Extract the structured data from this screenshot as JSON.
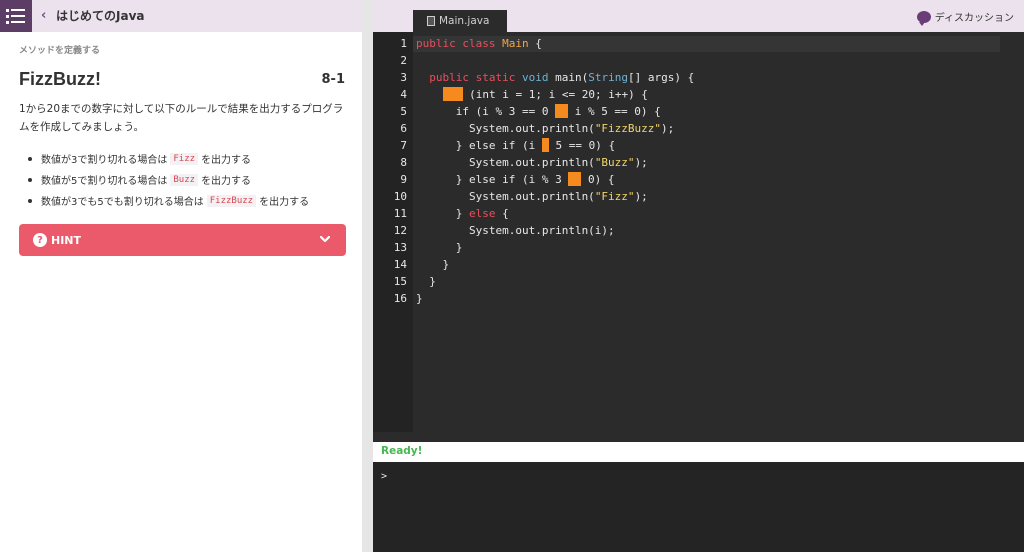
{
  "header": {
    "course_title": "はじめてのJava",
    "discussion_label": "ディスカッション"
  },
  "exercise": {
    "section_label": "メソッドを定義する",
    "title": "FizzBuzz!",
    "number": "8-1",
    "description": "1から20までの数字に対して以下のルールで結果を出力するプログラムを作成してみましょう。",
    "rules": [
      {
        "before": "数値が3で割り切れる場合は",
        "code": "Fizz",
        "after": "を出力する"
      },
      {
        "before": "数値が5で割り切れる場合は",
        "code": "Buzz",
        "after": "を出力する"
      },
      {
        "before": "数値が3でも5でも割り切れる場合は",
        "code": "FizzBuzz",
        "after": "を出力する"
      }
    ],
    "hint_label": "HINT"
  },
  "editor": {
    "file_tab": "Main.java",
    "line_numbers": [
      "1",
      "2",
      "3",
      "4",
      "5",
      "6",
      "7",
      "8",
      "9",
      "10",
      "11",
      "12",
      "13",
      "14",
      "15",
      "16"
    ]
  },
  "console": {
    "status": "Ready!",
    "prompt": ">"
  },
  "colors": {
    "accent_purple": "#5c3d66",
    "hint_red": "#ea5a6b",
    "blank_orange": "#f58a1f",
    "ready_green": "#48b453"
  }
}
